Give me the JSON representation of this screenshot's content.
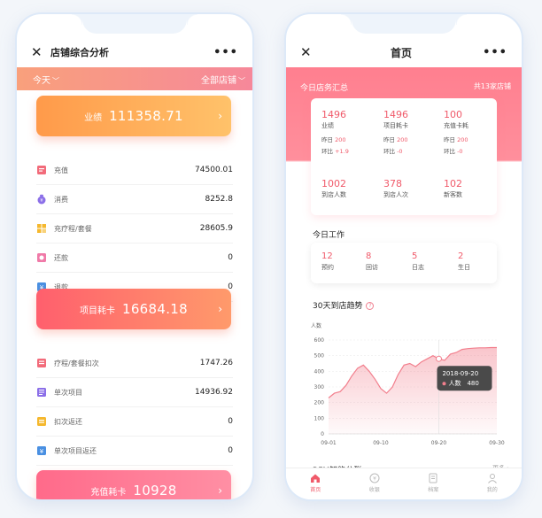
{
  "left": {
    "title": "店铺综合分析",
    "filter_period": "今天",
    "filter_store": "全部店铺",
    "cards": [
      {
        "label": "业绩",
        "value": "111358.71"
      },
      {
        "label": "项目耗卡",
        "value": "16684.18"
      },
      {
        "label": "充值耗卡",
        "value": "10928"
      }
    ],
    "rows_a": [
      {
        "name": "充值",
        "value": "74500.01",
        "icon": "recharge-icon",
        "color": "#f26b7a"
      },
      {
        "name": "消费",
        "value": "8252.8",
        "icon": "money-bag-icon",
        "color": "#8b6fe8"
      },
      {
        "name": "充疗程/套餐",
        "value": "28605.9",
        "icon": "package-grid-icon",
        "color": "#f5b82e"
      },
      {
        "name": "还款",
        "value": "0",
        "icon": "repayment-icon",
        "color": "#f07aa8"
      },
      {
        "name": "退款",
        "value": "0",
        "icon": "refund-icon",
        "color": "#4a90e2"
      }
    ],
    "rows_b": [
      {
        "name": "疗程/套餐扣次",
        "value": "1747.26",
        "icon": "deduct-icon",
        "color": "#f26b7a"
      },
      {
        "name": "单次项目",
        "value": "14936.92",
        "icon": "single-item-icon",
        "color": "#8b6fe8"
      },
      {
        "name": "扣次返还",
        "value": "0",
        "icon": "return-icon",
        "color": "#f5b82e"
      },
      {
        "name": "单次项目返还",
        "value": "0",
        "icon": "single-return-icon",
        "color": "#4a90e2"
      }
    ]
  },
  "right": {
    "title": "首页",
    "summary_title": "今日店务汇总",
    "summary_right": "共13家店铺",
    "summary": [
      {
        "value": "1496",
        "label": "业绩",
        "y_label": "昨日",
        "y_value": "200",
        "c_label": "环比",
        "c_value": "+1.9"
      },
      {
        "value": "1496",
        "label": "项目耗卡",
        "y_label": "昨日",
        "y_value": "200",
        "c_label": "环比",
        "c_value": "-0"
      },
      {
        "value": "100",
        "label": "充值卡耗",
        "y_label": "昨日",
        "y_value": "200",
        "c_label": "环比",
        "c_value": "-0"
      },
      {
        "value": "1002",
        "label": "到店人数"
      },
      {
        "value": "378",
        "label": "到店人次"
      },
      {
        "value": "102",
        "label": "新客数"
      }
    ],
    "work_title": "今日工作",
    "work": [
      {
        "value": "12",
        "label": "预约"
      },
      {
        "value": "8",
        "label": "回访"
      },
      {
        "value": "5",
        "label": "日志"
      },
      {
        "value": "2",
        "label": "生日"
      }
    ],
    "trend_title": "30天到店趋势",
    "rfm_title": "RFM智能分群",
    "rfm_more": "更多",
    "tabs": [
      {
        "label": "首页",
        "icon": "home-icon",
        "active": true
      },
      {
        "label": "收银",
        "icon": "cashier-icon",
        "active": false
      },
      {
        "label": "档案",
        "icon": "archive-icon",
        "active": false
      },
      {
        "label": "我的",
        "icon": "profile-icon",
        "active": false
      }
    ]
  },
  "chart_data": {
    "type": "area",
    "title": "30天到店趋势",
    "ylabel": "人数",
    "ylim": [
      0,
      600
    ],
    "yticks": [
      0,
      100,
      200,
      300,
      400,
      500,
      600
    ],
    "xticks": [
      "09-01",
      "09-10",
      "09-20",
      "09-30"
    ],
    "x": [
      "09-01",
      "09-02",
      "09-03",
      "09-04",
      "09-05",
      "09-06",
      "09-07",
      "09-08",
      "09-09",
      "09-10",
      "09-11",
      "09-12",
      "09-13",
      "09-14",
      "09-15",
      "09-16",
      "09-17",
      "09-18",
      "09-19",
      "09-20",
      "09-21",
      "09-22",
      "09-23",
      "09-24",
      "09-25",
      "09-26",
      "09-27",
      "09-28",
      "09-29",
      "09-30"
    ],
    "values": [
      230,
      260,
      270,
      310,
      370,
      420,
      440,
      400,
      350,
      290,
      260,
      300,
      380,
      440,
      450,
      430,
      460,
      480,
      500,
      480,
      470,
      510,
      520,
      540,
      545,
      548,
      550,
      550,
      552,
      552
    ],
    "tooltip": {
      "date": "2018-09-20",
      "label": "人数",
      "value": "480"
    },
    "color": "#f27f8d"
  }
}
